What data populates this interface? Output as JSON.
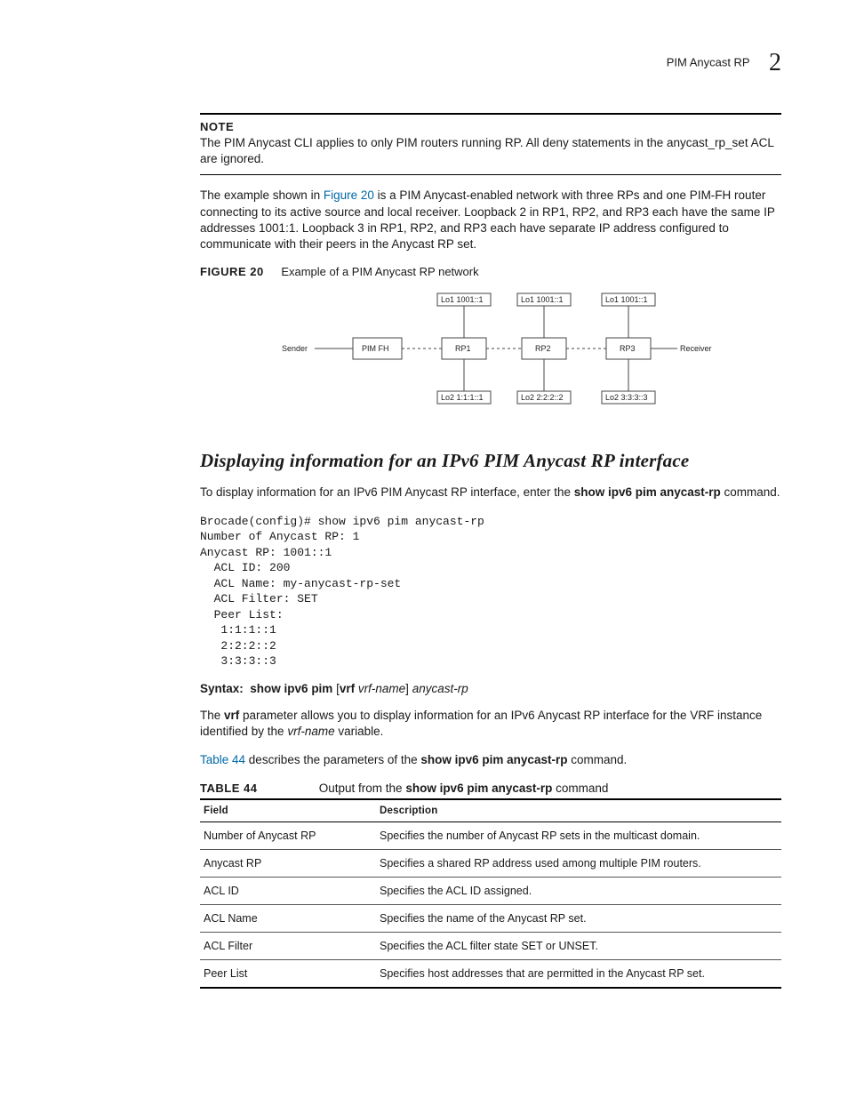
{
  "header": {
    "title": "PIM Anycast RP",
    "chapter": "2"
  },
  "note": {
    "label": "NOTE",
    "body": "The PIM Anycast CLI applies to only PIM routers running RP. All deny statements in the anycast_rp_set ACL are ignored."
  },
  "para1": {
    "pre": "The example shown in ",
    "link": "Figure 20",
    "post": " is a PIM Anycast-enabled network with three RPs and one PIM-FH router connecting to its active source and local receiver. Loopback 2 in RP1, RP2, and RP3 each have the same IP addresses 1001:1. Loopback 3 in RP1, RP2, and RP3 each have separate IP address configured to communicate with their peers in the Anycast RP set."
  },
  "figure": {
    "label": "FIGURE 20",
    "caption": "Example of a PIM Anycast RP network"
  },
  "diagram": {
    "sender": "Sender",
    "receiver": "Receiver",
    "pimfh": "PIM FH",
    "rp1": "RP1",
    "rp2": "RP2",
    "rp3": "RP3",
    "lo1a": "Lo1 1001::1",
    "lo1b": "Lo1 1001::1",
    "lo1c": "Lo1 1001::1",
    "lo2a": "Lo2 1:1:1::1",
    "lo2b": "Lo2 2:2:2::2",
    "lo2c": "Lo2 3:3:3::3"
  },
  "section_title": "Displaying information for an IPv6 PIM Anycast RP interface",
  "para2": {
    "pre": "To display information for an IPv6 PIM Anycast RP interface, enter the ",
    "cmd": "show ipv6 pim anycast-rp",
    "post": " command."
  },
  "code": "Brocade(config)# show ipv6 pim anycast-rp\nNumber of Anycast RP: 1\nAnycast RP: 1001::1\n  ACL ID: 200\n  ACL Name: my-anycast-rp-set\n  ACL Filter: SET\n  Peer List:\n   1:1:1::1\n   2:2:2::2\n   3:3:3::3",
  "syntax": {
    "label": "Syntax:",
    "cmd1": "show ipv6 pim",
    "opt": "[",
    "vrf": "vrf",
    "vrfname": "vrf-name",
    "close": "]",
    "anycast": "anycast-rp"
  },
  "para3": {
    "pre": "The ",
    "vrf": "vrf",
    "mid": " parameter allows you to display information for an IPv6 Anycast RP interface for the VRF instance identified by the ",
    "vrfname": "vrf-name",
    "post": " variable."
  },
  "para4": {
    "link": "Table 44",
    "mid": " describes the parameters of the ",
    "cmd": "show ipv6 pim anycast-rp",
    "post": " command."
  },
  "table": {
    "label": "TABLE 44",
    "caption_pre": "Output from the ",
    "caption_cmd": "show ipv6 pim anycast-rp",
    "caption_post": " command",
    "head_field": "Field",
    "head_desc": "Description",
    "rows": [
      {
        "f": "Number of Anycast RP",
        "d": "Specifies the number of Anycast RP sets in the multicast domain."
      },
      {
        "f": "Anycast RP",
        "d": "Specifies a shared RP address used among multiple PIM routers."
      },
      {
        "f": "ACL ID",
        "d": "Specifies the ACL ID assigned."
      },
      {
        "f": "ACL Name",
        "d": "Specifies the name of the Anycast RP set."
      },
      {
        "f": "ACL Filter",
        "d": "Specifies the ACL filter state SET or UNSET."
      },
      {
        "f": "Peer List",
        "d": "Specifies host addresses that are permitted in the Anycast RP set."
      }
    ]
  }
}
